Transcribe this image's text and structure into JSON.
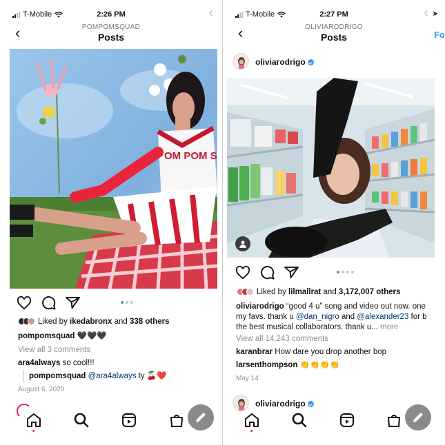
{
  "left": {
    "status": {
      "carrier": "T-Mobile",
      "time": "2:26 PM"
    },
    "header": {
      "username": "POMPOMSQUAD",
      "title": "Posts"
    },
    "photo": {
      "shirt_text": "OM POM SQU"
    },
    "likes": {
      "prefix": "Liked by ",
      "user": "ikedabronx",
      "middle": " and ",
      "others": "338 others"
    },
    "caption": {
      "username": "pompomsquad",
      "text": "🖤🖤🖤"
    },
    "view_comments": "View all 3 comments",
    "comments": [
      {
        "username": "ara4always",
        "text": "so cool!!!"
      },
      {
        "username": "pompomsquad",
        "mention": "@ara4always",
        "text": " ty 🍒❤️"
      }
    ],
    "date": "August 6, 2020"
  },
  "right": {
    "status": {
      "carrier": "T-Mobile",
      "time": "2:27 PM"
    },
    "header": {
      "username": "OLIVIARODRIGO",
      "title": "Posts",
      "follow": "Fo"
    },
    "post_user": "oliviarodrigo",
    "likes": {
      "prefix": "Liked by ",
      "user": "lilmallrat",
      "middle": " and ",
      "others": "3,172,007 others"
    },
    "caption": {
      "username": "oliviarodrigo",
      "line1": " “good 4 u” song and video out now. one",
      "line2a": "my favs. thank u ",
      "mention1": "@dan_nigro",
      "line2b": " and ",
      "mention2": "@alexander23",
      "line2c": " for b",
      "line3": "the best musical collaborators. thank u...",
      "more": " more"
    },
    "view_comments": "View all 14,243 comments",
    "comments": [
      {
        "username": "karanbrar",
        "text": " How dare you drop another bop"
      },
      {
        "username": "larsenthompson",
        "text": " 👏👏👏👏"
      }
    ],
    "date": "May 14",
    "next_user": "oliviarodrigo"
  },
  "colors": {
    "accent": "#3897f0",
    "link": "#00376b",
    "muted": "#8e8e8e",
    "notification": "#e0245e"
  },
  "icons": [
    "back-icon",
    "heart-icon",
    "comment-icon",
    "share-icon",
    "home-icon",
    "search-icon",
    "reels-icon",
    "shop-icon",
    "pencil-icon",
    "verified-icon",
    "signal-icon",
    "wifi-icon",
    "moon-icon",
    "location-icon"
  ]
}
